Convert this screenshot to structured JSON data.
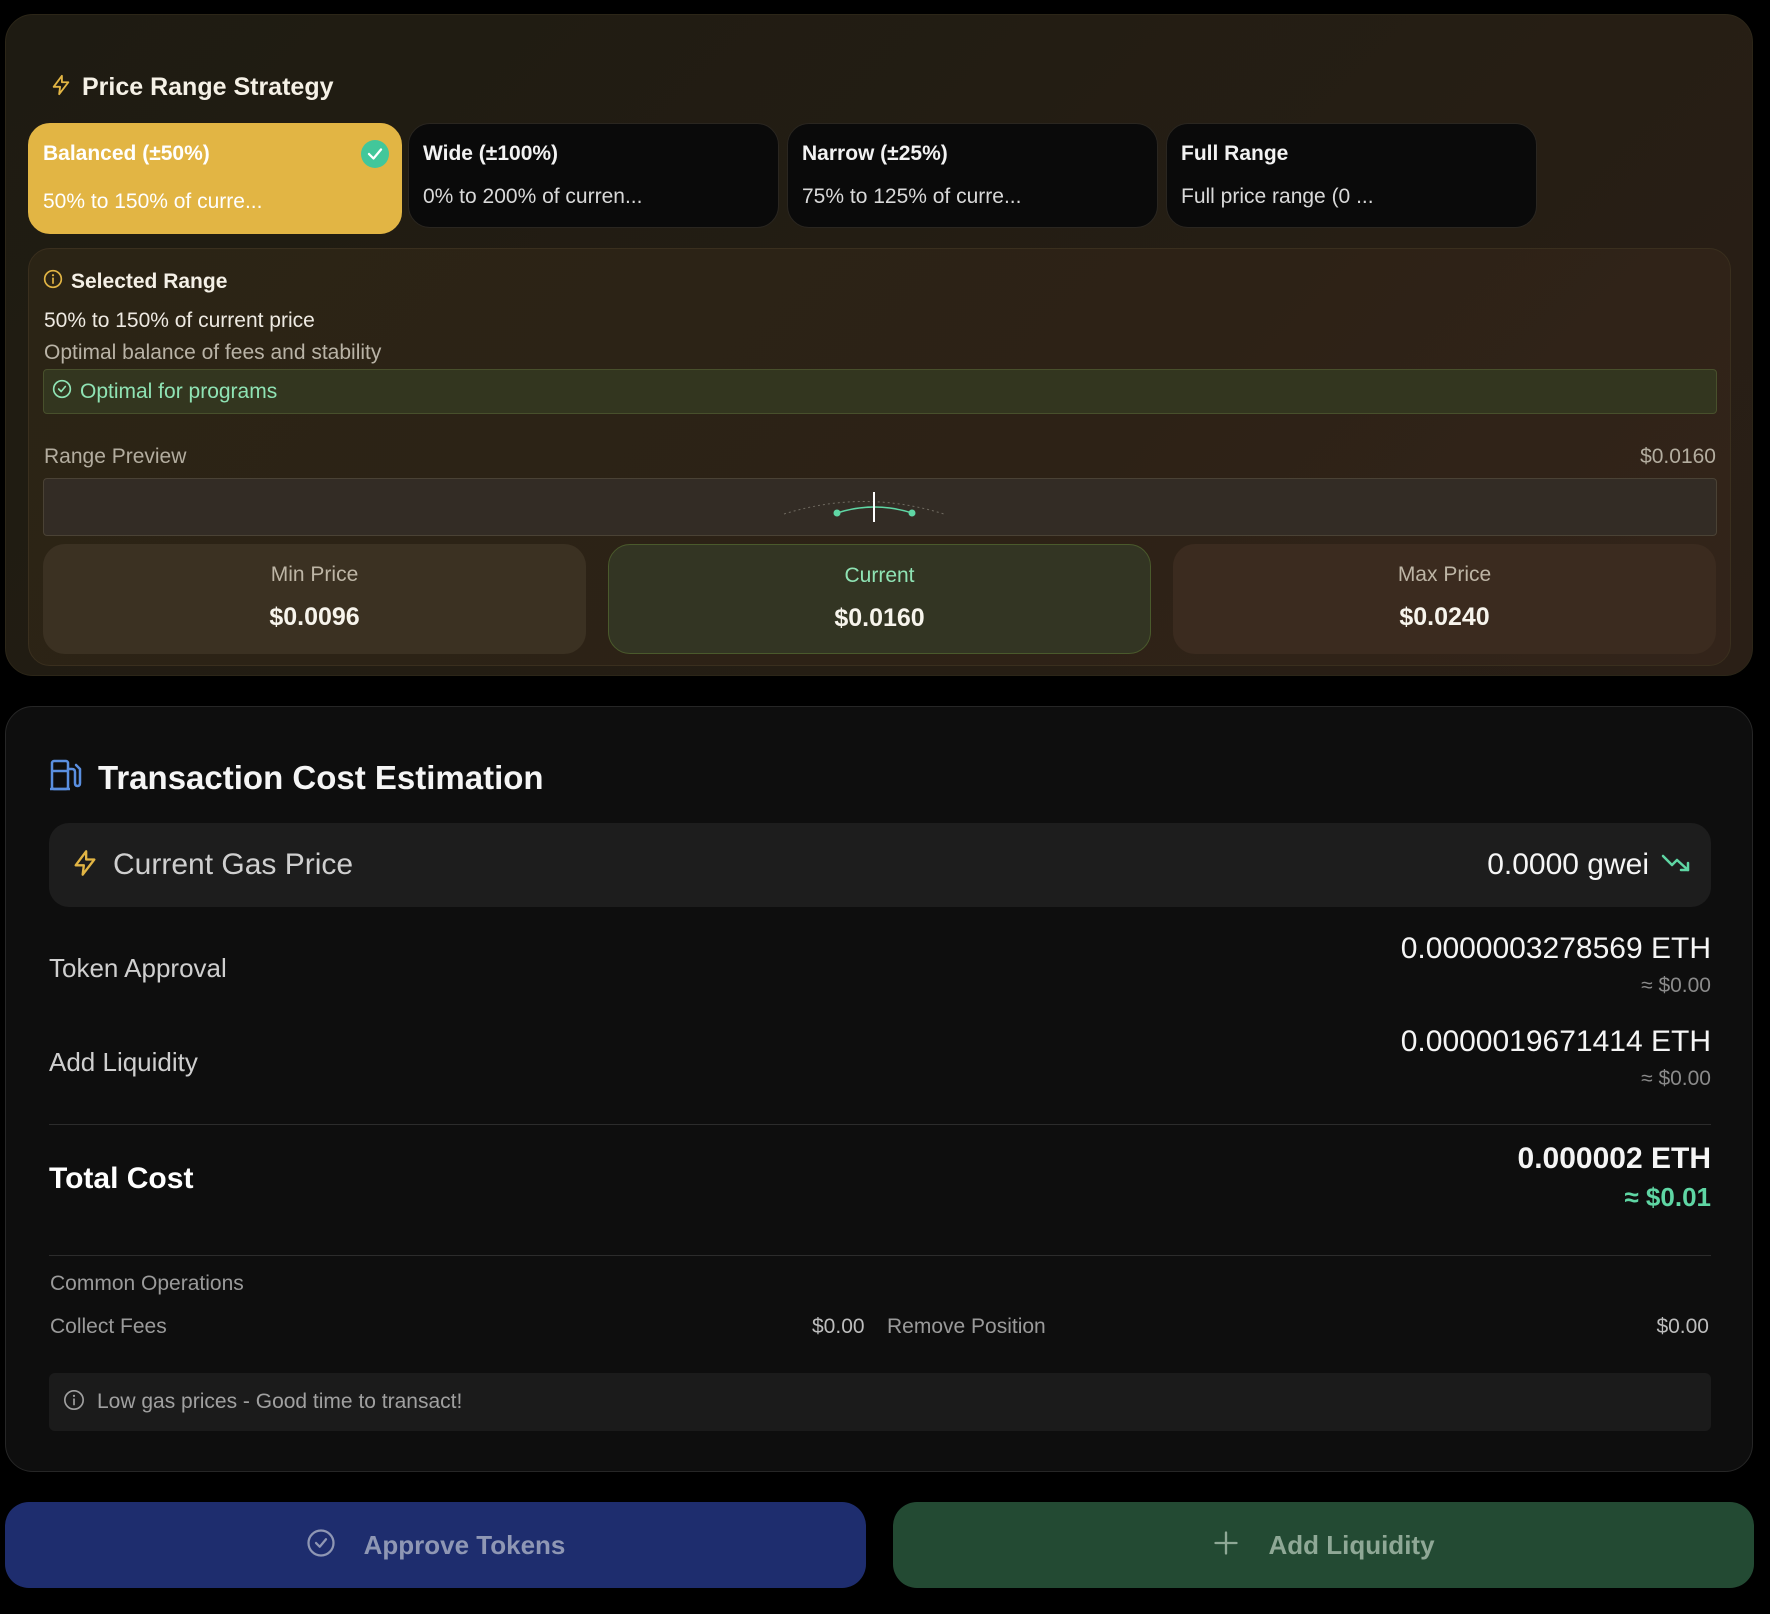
{
  "strategy": {
    "title": "Price Range Strategy",
    "options": [
      {
        "label": "Balanced (±50%)",
        "desc": "50% to 150% of curre...",
        "selected": true
      },
      {
        "label": "Wide (±100%)",
        "desc": "0% to 200% of curren...",
        "selected": false
      },
      {
        "label": "Narrow (±25%)",
        "desc": "75% to 125% of curre...",
        "selected": false
      },
      {
        "label": "Full Range",
        "desc": "Full price range (0 ...",
        "selected": false
      }
    ],
    "selected": {
      "title": "Selected Range",
      "range_text": "50% to 150% of current price",
      "note": "Optimal balance of fees and stability",
      "badge": "Optimal for programs",
      "preview_label": "Range Preview",
      "preview_value": "$0.0160",
      "min_label": "Min Price",
      "min_value": "$0.0096",
      "current_label": "Current",
      "current_value": "$0.0160",
      "max_label": "Max Price",
      "max_value": "$0.0240"
    }
  },
  "cost": {
    "title": "Transaction Cost Estimation",
    "gas_label": "Current Gas Price",
    "gas_value": "0.0000 gwei",
    "token_approval_label": "Token Approval",
    "token_approval_eth": "0.0000003278569 ETH",
    "token_approval_usd": "≈ $0.00",
    "add_liquidity_label": "Add Liquidity",
    "add_liquidity_eth": "0.0000019671414 ETH",
    "add_liquidity_usd": "≈ $0.00",
    "total_label": "Total Cost",
    "total_eth": "0.000002 ETH",
    "total_usd": "≈ $0.01",
    "common_label": "Common Operations",
    "collect_fees_label": "Collect Fees",
    "collect_fees_value": "$0.00",
    "remove_position_label": "Remove Position",
    "remove_position_value": "$0.00",
    "notice": "Low gas prices - Good time to transact!"
  },
  "actions": {
    "approve_label": "Approve Tokens",
    "add_label": "Add Liquidity"
  },
  "colors": {
    "accent_gold": "#e2b544",
    "accent_green": "#5fd6a4",
    "approve_bg": "#1e2d6e",
    "add_bg": "#234a33"
  }
}
